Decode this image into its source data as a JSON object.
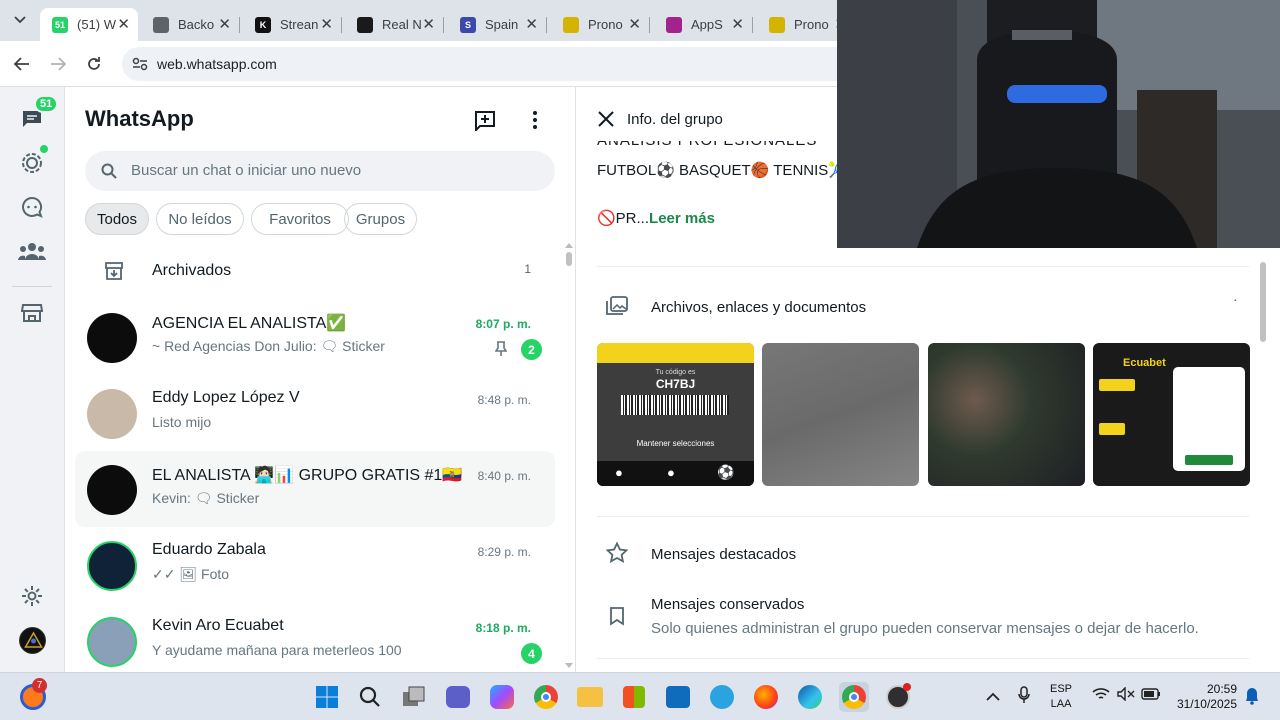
{
  "browser": {
    "tabs": [
      {
        "title": "(51) W",
        "fav_text": "51",
        "fav_color": "#25d366",
        "active": true
      },
      {
        "title": "Backo",
        "fav_text": "",
        "fav_color": "#5f6368",
        "active": false
      },
      {
        "title": "Strean",
        "fav_text": "K",
        "fav_color": "#111111",
        "active": false
      },
      {
        "title": "Real N",
        "fav_text": "",
        "fav_color": "#1a1a1a",
        "active": false
      },
      {
        "title": "Spain",
        "fav_text": "S",
        "fav_color": "#3b4aa8",
        "active": false
      },
      {
        "title": "Prono",
        "fav_text": "",
        "fav_color": "#d4b400",
        "active": false
      },
      {
        "title": "AppS",
        "fav_text": "",
        "fav_color": "#a3238e",
        "active": false
      },
      {
        "title": "Prono",
        "fav_text": "",
        "fav_color": "#d4b400",
        "active": false
      }
    ],
    "url": "web.whatsapp.com"
  },
  "rail": {
    "chats_badge": "51"
  },
  "chatlist": {
    "title": "WhatsApp",
    "search_placeholder": "Buscar un chat o iniciar uno nuevo",
    "filters": [
      "Todos",
      "No leídos",
      "Favoritos",
      "Grupos"
    ],
    "archived_label": "Archivados",
    "archived_count": "1",
    "chats": [
      {
        "name": "AGENCIA EL ANALISTA✅",
        "preview": "~ Red Agencias Don Julio: 🗨 Sticker",
        "time": "8:07 p. m.",
        "unread": "2",
        "pinned": true,
        "time_green": true,
        "avatar_color": "#0c0c0c"
      },
      {
        "name": "Eddy Lopez López V",
        "preview": "Listo mijo",
        "time": "8:48 p. m.",
        "unread": "",
        "pinned": false,
        "time_green": false,
        "avatar_color": "#c9b9a8"
      },
      {
        "name": "EL ANALISTA 🧑🏻‍💻📊 GRUPO GRATIS #1🇪🇨",
        "preview": "Kevin: 🗨 Sticker",
        "time": "8:40 p. m.",
        "unread": "",
        "pinned": false,
        "time_green": false,
        "avatar_color": "#0c0c0c"
      },
      {
        "name": "Eduardo Zabala",
        "preview": "✓✓ 🖼 Foto",
        "time": "8:29 p. m.",
        "unread": "",
        "pinned": false,
        "time_green": false,
        "avatar_color": "#0f2238"
      },
      {
        "name": "Kevin Aro Ecuabet",
        "preview": "Y ayudame mañana para meterleos 100",
        "time": "8:18 p. m.",
        "unread": "4",
        "pinned": false,
        "time_green": true,
        "avatar_color": "#8aa0b8"
      }
    ]
  },
  "info": {
    "header": "Info. del grupo",
    "desc_line1": "ANALISIS PROFESIONALES",
    "desc_line2": "FUTBOL⚽ BASQUET🏀 TENNIS🎾",
    "desc_line3": "🚫PR...",
    "read_more": "Leer más",
    "media_title": "Archivos, enlaces y documentos",
    "thumb1_code_label": "Tu código es",
    "thumb1_code": "CH7BJ",
    "thumb1_button": "Mantener selecciones",
    "thumb4_brand": "Ecuabet",
    "starred": "Mensajes destacados",
    "kept_title": "Mensajes conservados",
    "kept_sub": "Solo quienes administran el grupo pueden conservar mensajes o dejar de hacerlo."
  },
  "taskbar": {
    "notif_badge": "7",
    "lang1": "ESP",
    "lang2": "LAA",
    "time": "20:59",
    "date": "31/10/2025"
  },
  "colors": {
    "accent": "#25d366",
    "link_green": "#1a8a4c",
    "rail_bg": "#f0f2f5"
  }
}
